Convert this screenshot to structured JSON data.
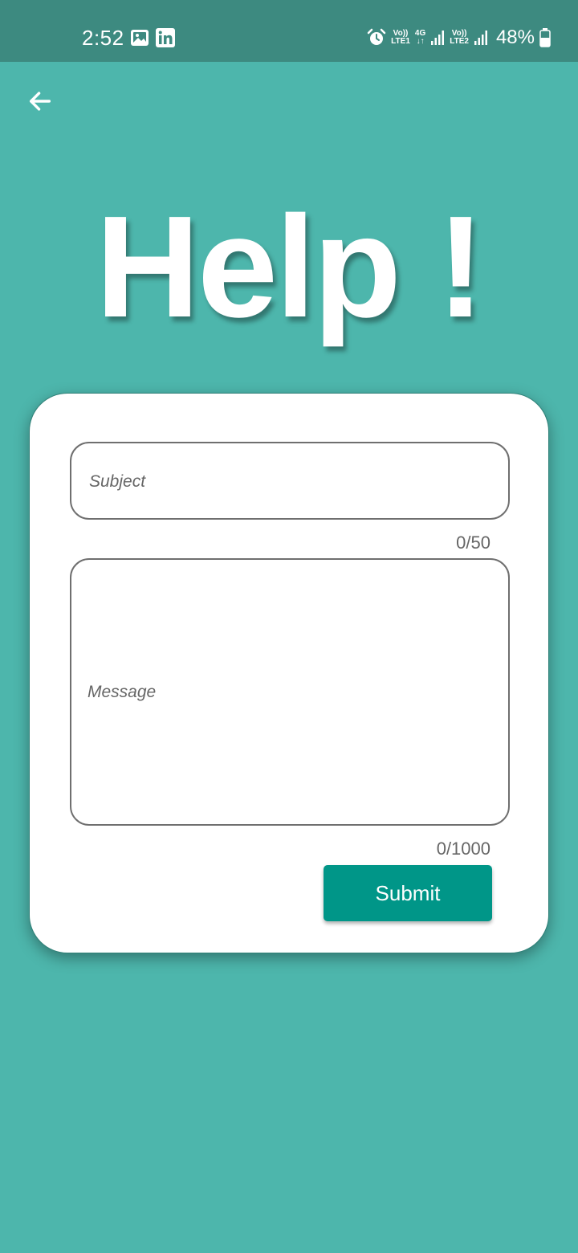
{
  "status_bar": {
    "time": "2:52",
    "notification_icons": [
      "gallery-icon",
      "linkedin-icon"
    ],
    "alarm_icon": "alarm-icon",
    "sim1": {
      "top": "Vo))",
      "bottom": "LTE1"
    },
    "network": {
      "top": "4G",
      "bottom": "↓↑"
    },
    "sim2": {
      "top": "Vo))",
      "bottom": "LTE2"
    },
    "battery_percent": "48%"
  },
  "header": {
    "back_icon": "arrow-left-icon",
    "title": "Help !"
  },
  "form": {
    "subject": {
      "placeholder": "Subject",
      "value": "",
      "counter": "0/50"
    },
    "message": {
      "placeholder": "Message",
      "value": "",
      "counter": "0/1000"
    },
    "submit_label": "Submit"
  },
  "colors": {
    "background": "#4db6ac",
    "status_bar": "#3d8a80",
    "accent": "#009688",
    "card": "#ffffff"
  }
}
